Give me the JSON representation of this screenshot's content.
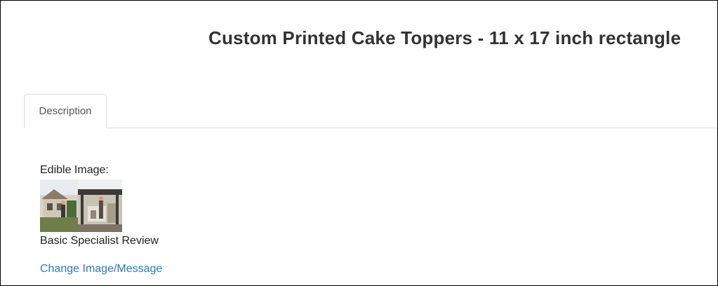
{
  "product": {
    "title": "Custom Printed Cake Toppers - 11 x 17 inch rectangle"
  },
  "tabs": [
    {
      "label": "Description",
      "active": true
    }
  ],
  "description": {
    "edible_image_label": "Edible Image:",
    "thumbnail_icon": "edible-image-thumbnail",
    "review_level": "Basic Specialist Review",
    "change_link": "Change Image/Message"
  },
  "colors": {
    "link": "#2c7bbd",
    "title": "#333333",
    "border": "#dddddd"
  }
}
